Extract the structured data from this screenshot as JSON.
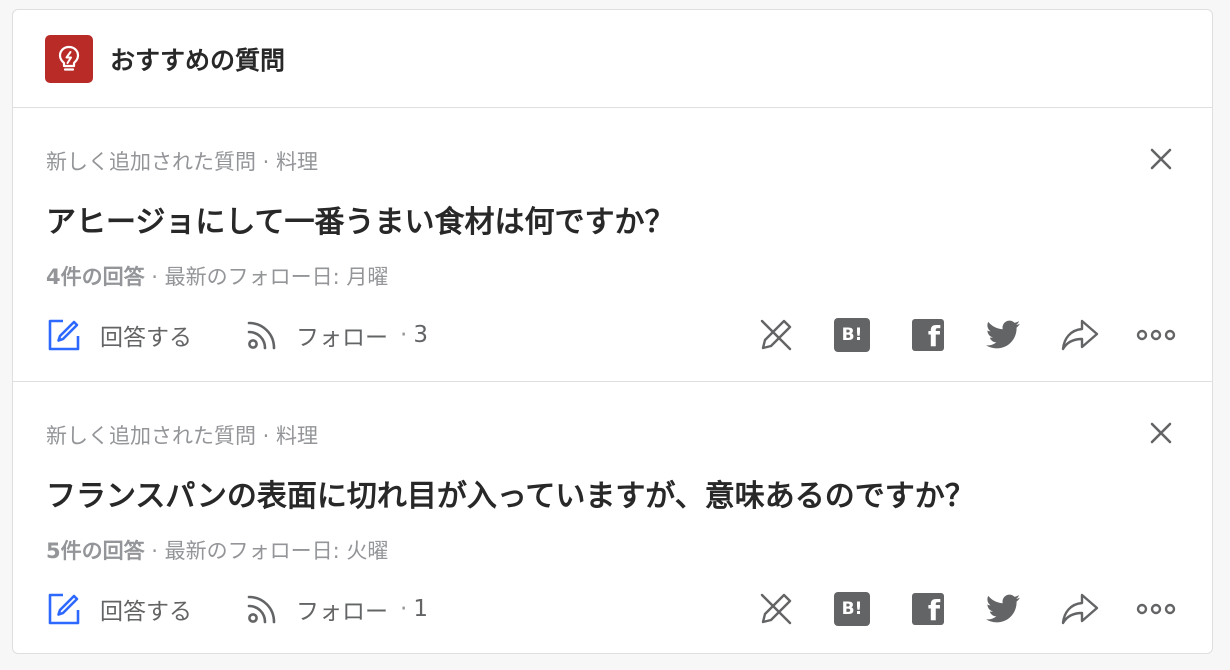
{
  "header": {
    "title": "おすすめの質問",
    "icon": "lightbulb-icon",
    "icon_bg": "#b92b27"
  },
  "questions": [
    {
      "context": "新しく追加された質問 · 料理",
      "title": "アヒージョにして一番うまい食材は何ですか？",
      "answers": "4件の回答",
      "last_follow": " · 最新のフォロー日: 月曜",
      "answer_label": "回答する",
      "follow_label": "フォロー",
      "follow_sep": "·",
      "follow_count": "3",
      "hatena_label": "B!",
      "facebook_label": "f"
    },
    {
      "context": "新しく追加された質問 · 料理",
      "title": "フランスパンの表面に切れ目が入っていますが、意味あるのですか？",
      "answers": "5件の回答",
      "last_follow": " · 最新のフォロー日: 火曜",
      "answer_label": "回答する",
      "follow_label": "フォロー",
      "follow_sep": "·",
      "follow_count": "1",
      "hatena_label": "B!",
      "facebook_label": "f"
    }
  ],
  "colors": {
    "accent_blue": "#2e69ff",
    "icon_gray": "#636466",
    "muted": "#939598"
  }
}
